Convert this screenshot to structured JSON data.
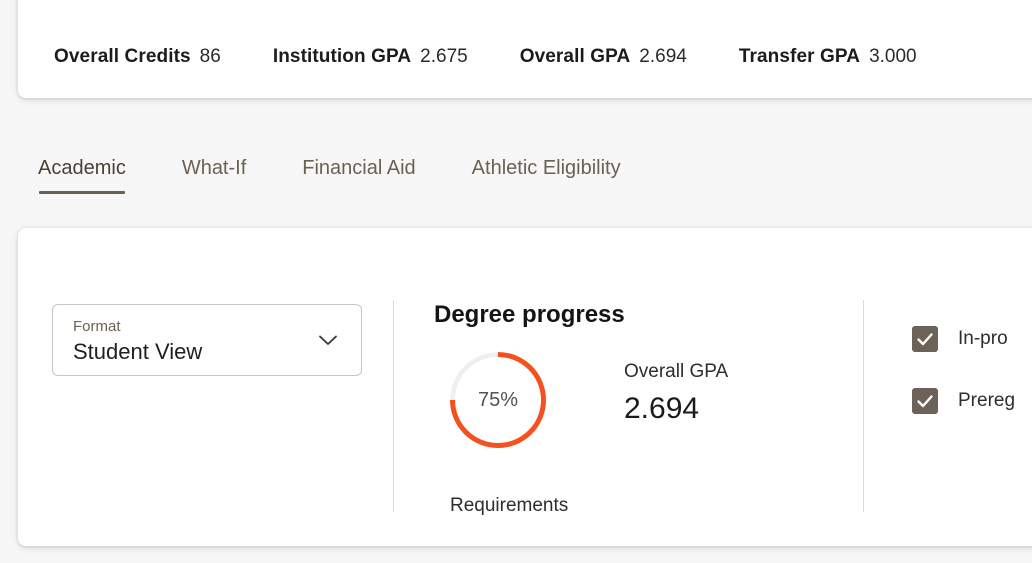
{
  "header": {
    "stats": [
      {
        "label": "Overall Credits",
        "value": "86"
      },
      {
        "label": "Institution GPA",
        "value": "2.675"
      },
      {
        "label": "Overall GPA",
        "value": "2.694"
      },
      {
        "label": "Transfer GPA",
        "value": "3.000"
      }
    ]
  },
  "tabs": [
    {
      "label": "Academic",
      "active": true
    },
    {
      "label": "What-If",
      "active": false
    },
    {
      "label": "Financial Aid",
      "active": false
    },
    {
      "label": "Athletic Eligibility",
      "active": false
    }
  ],
  "format_select": {
    "label": "Format",
    "value": "Student View",
    "icon": "chevron-down-icon"
  },
  "degree_progress": {
    "title": "Degree progress",
    "percent_label": "75%",
    "percent_value": 75,
    "requirements_label": "Requirements",
    "gpa_label": "Overall GPA",
    "gpa_value": "2.694"
  },
  "legend": {
    "items": [
      {
        "label": "In-pro",
        "checked": true,
        "icon": "checkbox-checked-icon"
      },
      {
        "label": "Prereg",
        "checked": true,
        "icon": "checkbox-checked-icon"
      }
    ]
  },
  "colors": {
    "progress_arc": "#f4511e",
    "progress_track": "#f1eeec",
    "checkbox_fill": "#6d6257",
    "tab_accent": "#6b6054",
    "page_background": "#f7f7f7",
    "card_background": "#ffffff"
  }
}
